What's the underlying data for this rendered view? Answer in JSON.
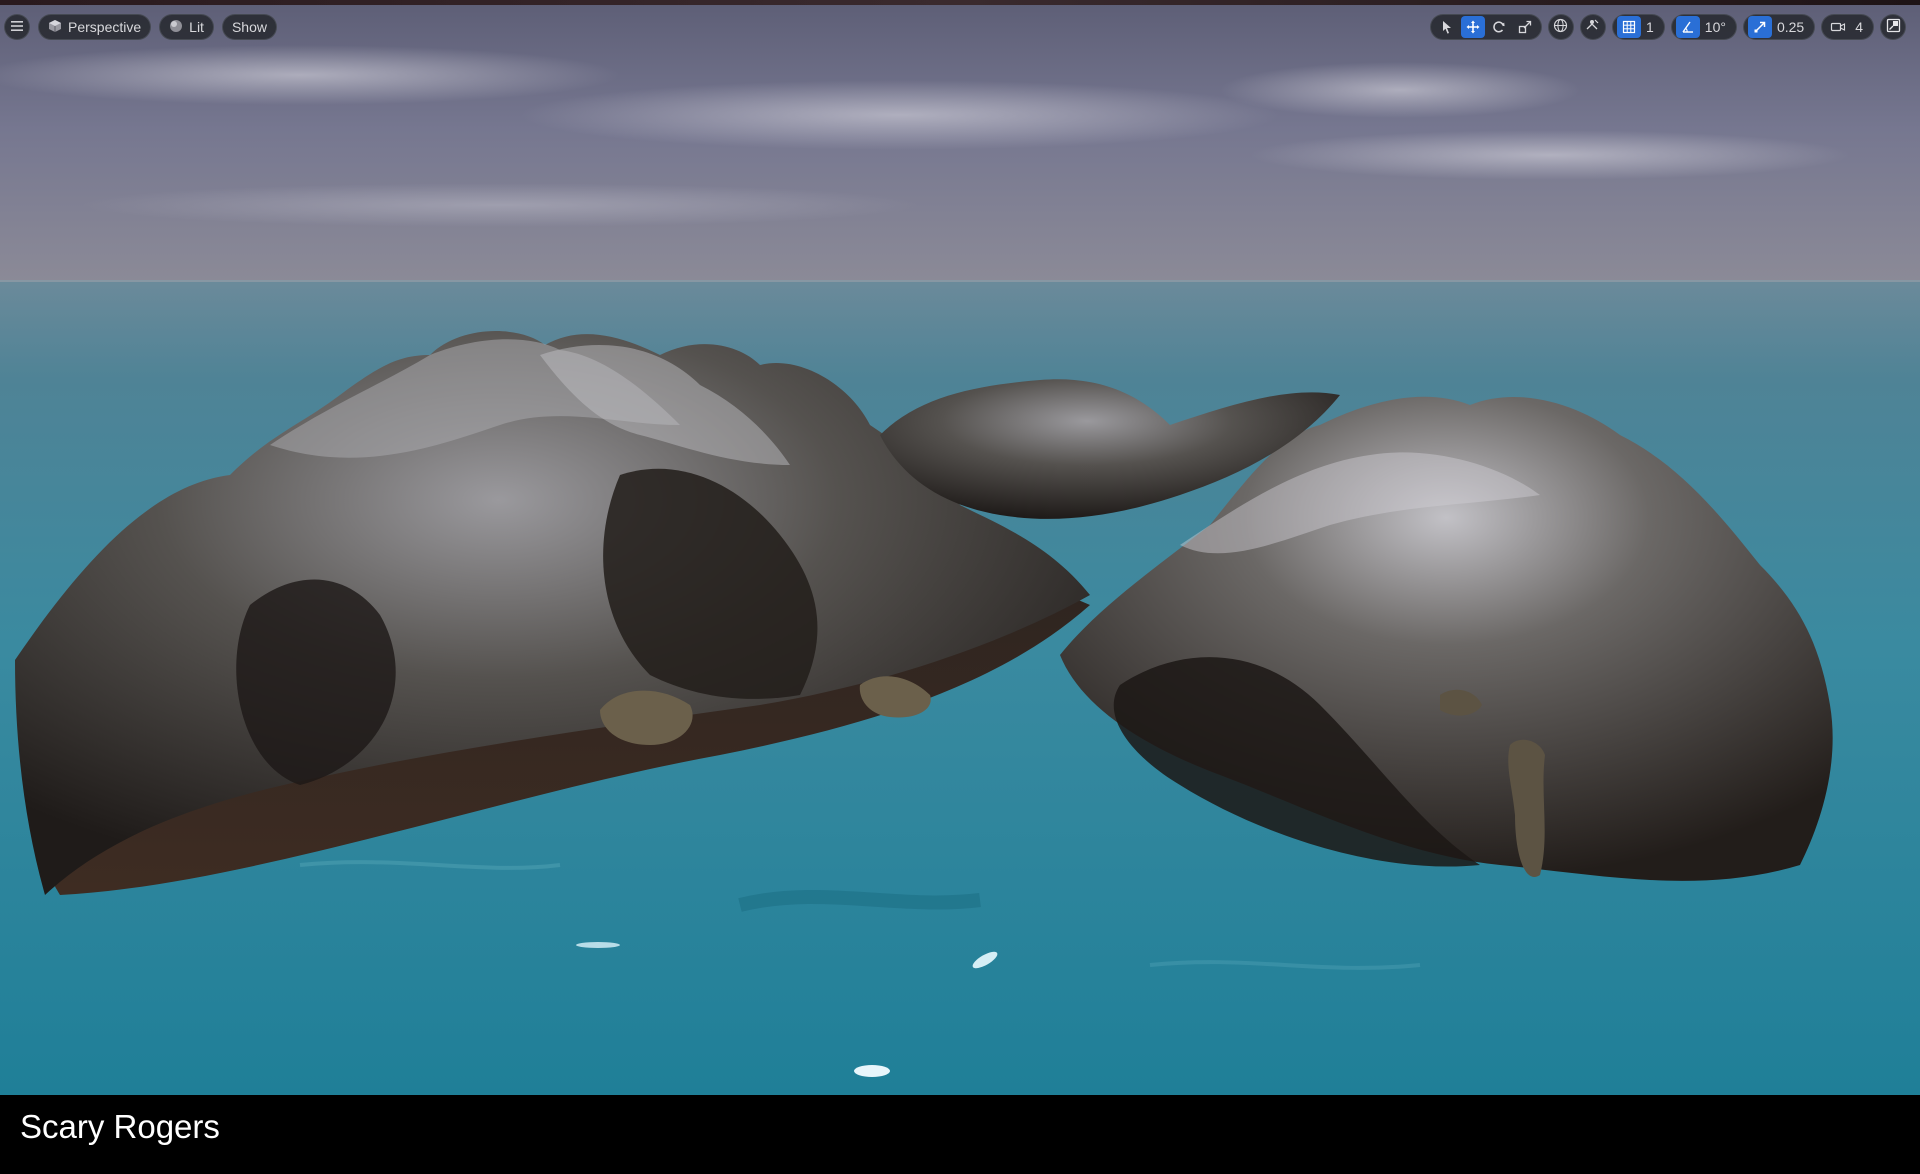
{
  "toolbar": {
    "menu_icon": "hamburger-menu-icon",
    "view_mode": {
      "icon": "cube-icon",
      "label": "Perspective"
    },
    "lighting": {
      "icon": "sphere-icon",
      "label": "Lit"
    },
    "show_label": "Show",
    "transform_tools": [
      "select-arrow-icon",
      "translate-move-icon",
      "rotate-icon",
      "scale-icon"
    ],
    "coordinate_space_icon": "globe-icon",
    "surface_snap_icon": "surface-snap-icon",
    "grid_snap": {
      "icon": "grid-snap-icon",
      "value": "1"
    },
    "rotation_snap": {
      "icon": "angle-snap-icon",
      "value": "10°"
    },
    "scale_snap": {
      "icon": "scale-snap-icon",
      "value": "0.25"
    },
    "camera_speed": {
      "icon": "camera-icon",
      "value": "4"
    },
    "maximize_icon": "maximize-viewport-icon"
  },
  "caption": "Scary Rogers",
  "colors": {
    "accent": "#2a6fd6",
    "water": "#2a8fa3",
    "sky": "#6e6f86",
    "rock": "#2a2624"
  }
}
